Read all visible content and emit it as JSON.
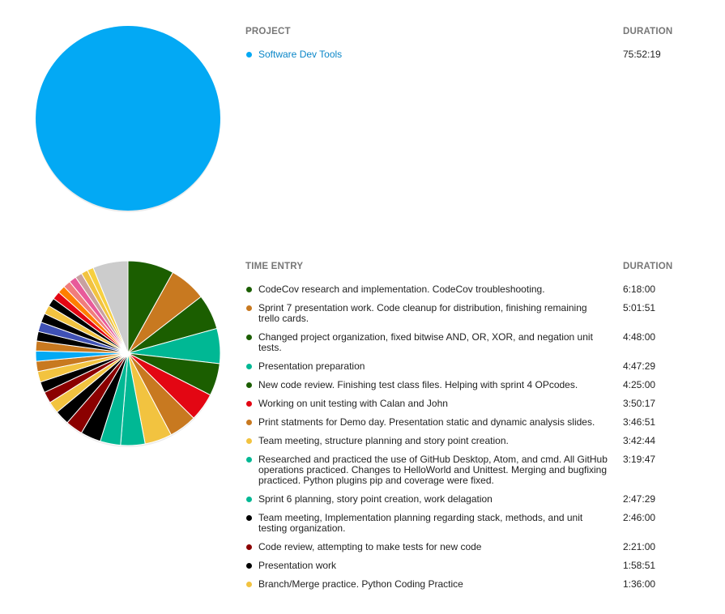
{
  "project_section": {
    "header_project": "PROJECT",
    "header_duration": "DURATION",
    "rows": [
      {
        "label": "Software Dev Tools",
        "duration": "75:52:19",
        "color": "#03a9f4"
      }
    ]
  },
  "entry_section": {
    "header_entry": "TIME ENTRY",
    "header_duration": "DURATION",
    "rows": [
      {
        "label": "CodeCov research and implementation. CodeCov troubleshooting.",
        "duration": "6:18:00",
        "color": "#1b5e00"
      },
      {
        "label": "Sprint 7 presentation work. Code cleanup for distribution, finishing remaining trello cards.",
        "duration": "5:01:51",
        "color": "#c87920"
      },
      {
        "label": "Changed project organization, fixed bitwise AND, OR, XOR, and negation unit tests.",
        "duration": "4:48:00",
        "color": "#1b5e00"
      },
      {
        "label": "Presentation preparation",
        "duration": "4:47:29",
        "color": "#00b894"
      },
      {
        "label": "New code review. Finishing test class files. Helping with sprint 4 OPcodes.",
        "duration": "4:25:00",
        "color": "#1b5e00"
      },
      {
        "label": "Working on unit testing with Calan and John",
        "duration": "3:50:17",
        "color": "#e30613"
      },
      {
        "label": "Print statments for Demo day. Presentation static and dynamic analysis slides.",
        "duration": "3:46:51",
        "color": "#c87920"
      },
      {
        "label": "Team meeting, structure planning and story point creation.",
        "duration": "3:42:44",
        "color": "#f2c340"
      },
      {
        "label": "Researched and practiced the use of GitHub Desktop, Atom, and cmd. All GitHub operations practiced. Changes to HelloWorld and Unittest. Merging and bugfixing practiced. Python plugins pip and coverage were fixed.",
        "duration": "3:19:47",
        "color": "#00b894"
      },
      {
        "label": "Sprint 6 planning, story point creation, work delagation",
        "duration": "2:47:29",
        "color": "#00b894"
      },
      {
        "label": "Team meeting, Implementation planning regarding stack, methods, and unit testing organization.",
        "duration": "2:46:00",
        "color": "#000000"
      },
      {
        "label": "Code review, attempting to make tests for new code",
        "duration": "2:21:00",
        "color": "#8b0000"
      },
      {
        "label": "Presentation work",
        "duration": "1:58:51",
        "color": "#000000"
      },
      {
        "label": "Branch/Merge practice. Python Coding Practice",
        "duration": "1:36:00",
        "color": "#f2c340"
      }
    ]
  },
  "chart_data": [
    {
      "type": "pie",
      "categories": [
        "Software Dev Tools"
      ],
      "values": [
        100
      ],
      "colors": [
        "#03a9f4"
      ]
    },
    {
      "type": "pie",
      "values": [
        6.3,
        5.03,
        4.8,
        4.79,
        4.42,
        3.84,
        3.78,
        3.71,
        3.33,
        2.79,
        2.77,
        2.35,
        1.98,
        1.6,
        1.55,
        1.5,
        1.45,
        1.4,
        1.4,
        1.35,
        1.3,
        1.3,
        1.25,
        1.2,
        1.15,
        1.1,
        1.05,
        1.0,
        1.0,
        0.95,
        0.9,
        0.85,
        4.8
      ],
      "colors": [
        "#1b5e00",
        "#c87920",
        "#1b5e00",
        "#00b894",
        "#1b5e00",
        "#e30613",
        "#c87920",
        "#f2c340",
        "#00b894",
        "#00b894",
        "#000000",
        "#8b0000",
        "#000000",
        "#f2c340",
        "#8b0000",
        "#000000",
        "#f2c340",
        "#c87920",
        "#03a9f4",
        "#c87920",
        "#000000",
        "#3f51b5",
        "#000000",
        "#f2c340",
        "#000000",
        "#e30613",
        "#ff7f00",
        "#f07c7c",
        "#e85a9a",
        "#c8a0a0",
        "#f2c340",
        "#f7d040",
        "#cccccc"
      ]
    }
  ]
}
